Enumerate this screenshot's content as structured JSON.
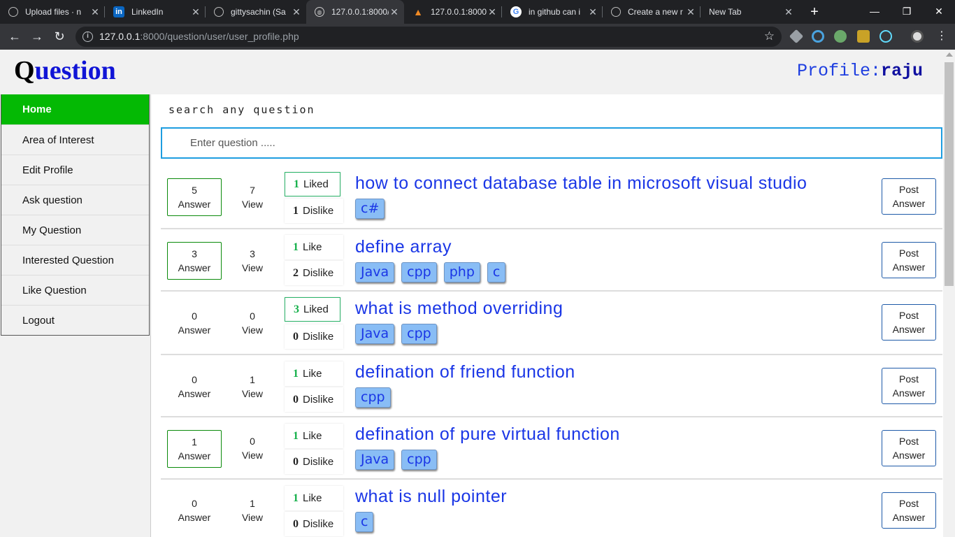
{
  "browser": {
    "tabs": [
      {
        "title": "Upload files · n",
        "icon": "github-icon"
      },
      {
        "title": "LinkedIn",
        "icon": "linkedin-icon"
      },
      {
        "title": "gittysachin (Sa",
        "icon": "github-icon"
      },
      {
        "title": "127.0.0.1:8000/",
        "icon": "globe-icon"
      },
      {
        "title": "127.0.0.1:8000",
        "icon": "xampp-icon"
      },
      {
        "title": "in github can i",
        "icon": "google-icon"
      },
      {
        "title": "Create a new r",
        "icon": "github-icon"
      },
      {
        "title": "New Tab",
        "icon": ""
      }
    ],
    "active_tab_index": 3,
    "url_host": "127.0.0.1",
    "url_rest": ":8000/question/user/user_profile.php"
  },
  "header": {
    "logo_first": "Q",
    "logo_rest": "uestion",
    "profile_label": "Profile:",
    "profile_user": "raju"
  },
  "sidebar": {
    "items": [
      {
        "label": "Home",
        "active": true
      },
      {
        "label": "Area of Interest"
      },
      {
        "label": "Edit Profile"
      },
      {
        "label": "Ask question"
      },
      {
        "label": "My Question"
      },
      {
        "label": "Interested Question"
      },
      {
        "label": "Like Question"
      },
      {
        "label": "Logout"
      }
    ]
  },
  "search": {
    "label": "search any question",
    "placeholder": "Enter question ....."
  },
  "labels": {
    "answer": "Answer",
    "view": "View",
    "dislike": "Dislike",
    "post": "Post",
    "answer_btn": "Answer"
  },
  "questions": [
    {
      "answers": "5",
      "views": "7",
      "likes": "1",
      "like_label": "Liked",
      "dislikes": "1",
      "title": "how to connect database table in microsoft visual studio",
      "tags": [
        "c#"
      ]
    },
    {
      "answers": "3",
      "views": "3",
      "likes": "1",
      "like_label": "Like",
      "dislikes": "2",
      "title": "define array",
      "tags": [
        "Java",
        "cpp",
        "php",
        "c"
      ]
    },
    {
      "answers": "0",
      "views": "0",
      "likes": "3",
      "like_label": "Liked",
      "dislikes": "0",
      "title": "what is method overriding",
      "tags": [
        "Java",
        "cpp"
      ]
    },
    {
      "answers": "0",
      "views": "1",
      "likes": "1",
      "like_label": "Like",
      "dislikes": "0",
      "title": "defination of friend function",
      "tags": [
        "cpp"
      ]
    },
    {
      "answers": "1",
      "views": "0",
      "likes": "1",
      "like_label": "Like",
      "dislikes": "0",
      "title": "defination of pure virtual function",
      "tags": [
        "Java",
        "cpp"
      ]
    },
    {
      "answers": "0",
      "views": "1",
      "likes": "1",
      "like_label": "Like",
      "dislikes": "0",
      "title": "what is null pointer",
      "tags": [
        "c"
      ]
    }
  ],
  "colors": {
    "accent_green": "#04b904",
    "link_blue": "#1a36e6",
    "tag_bg": "#89bdf5",
    "search_border": "#1e9de0"
  }
}
